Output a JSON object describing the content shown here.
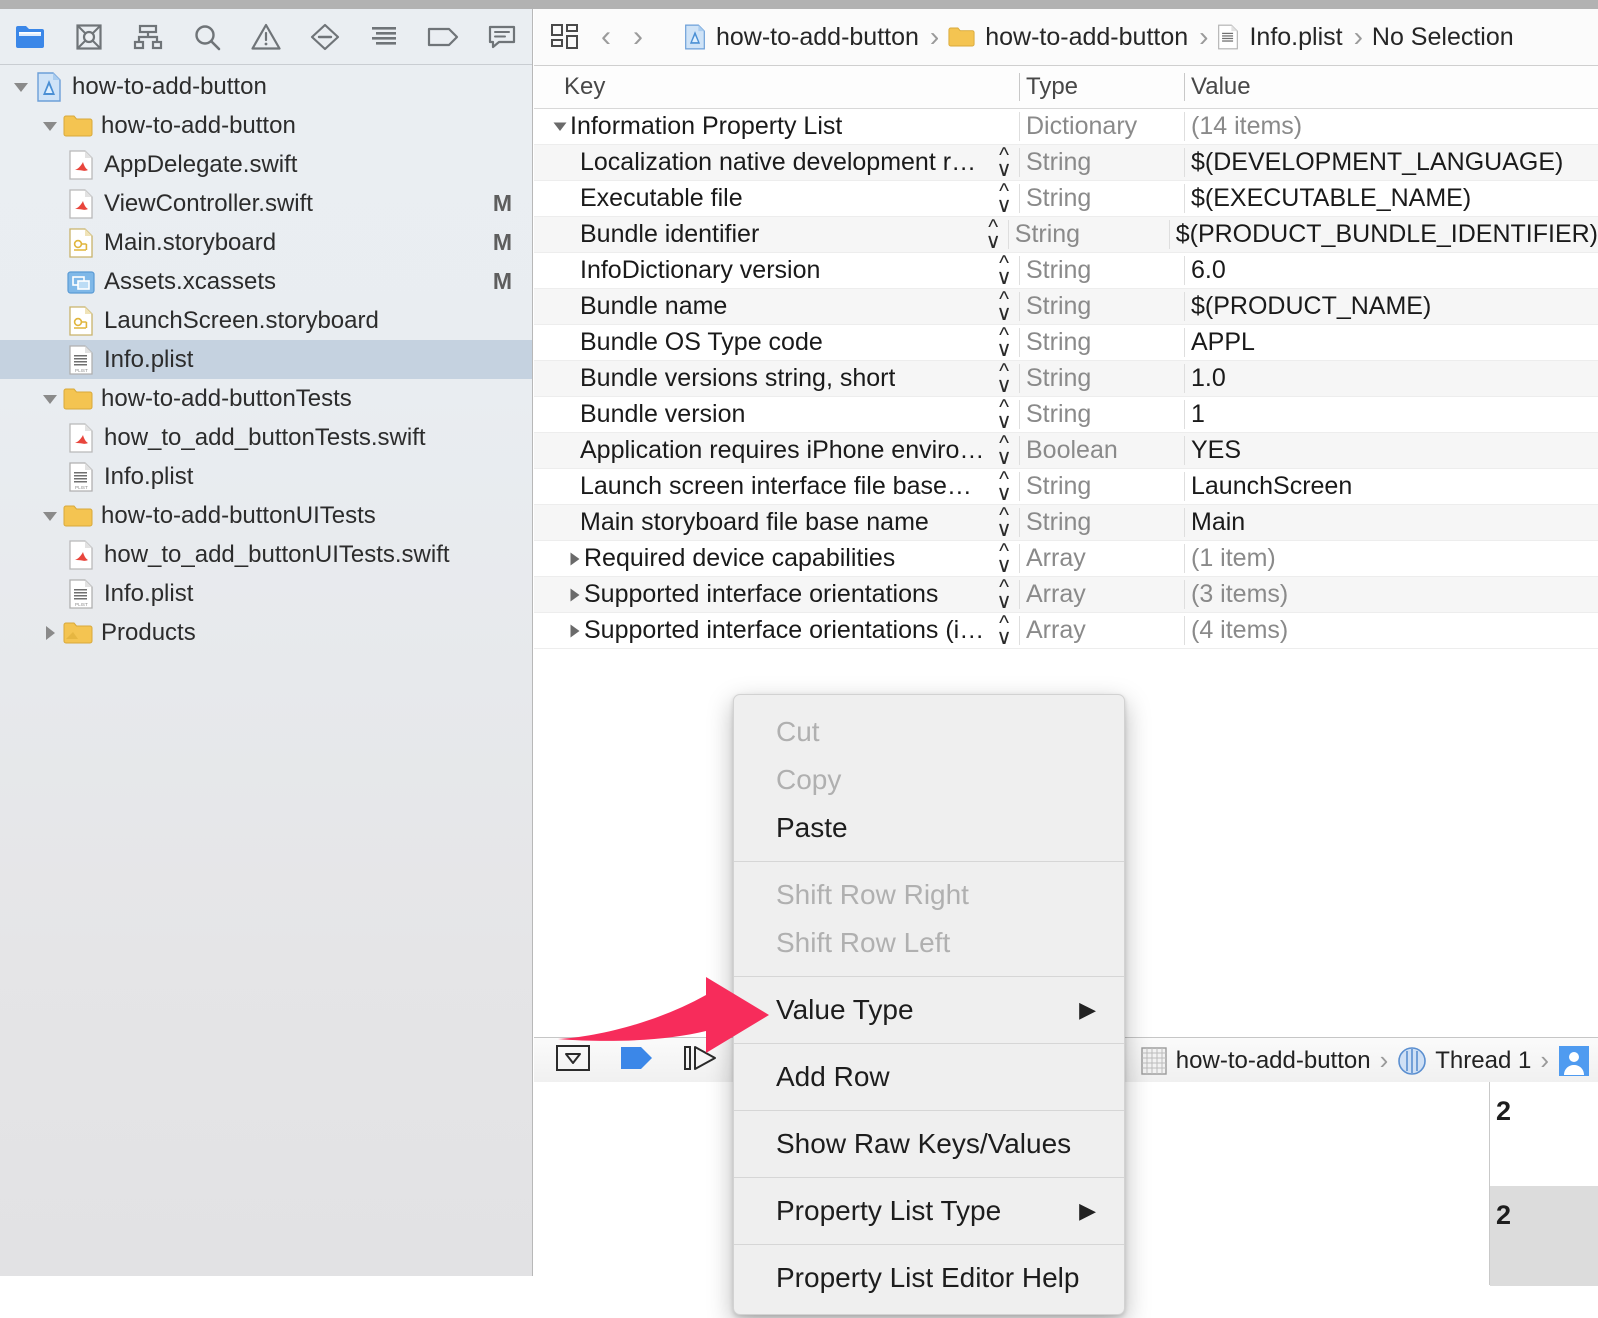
{
  "window": {
    "title": "Xcode — Info.plist"
  },
  "colors": {
    "accent_blue": "#3b87e8",
    "selection": "#c5d2e0",
    "arrow_pink": "#F72C5B",
    "menu_bg": "#efefef",
    "navigator_bg": "#e9edf1"
  },
  "navigator": {
    "toolbar_icons": [
      {
        "name": "project-navigator-icon",
        "label": "Project navigator",
        "selected": true
      },
      {
        "name": "source-control-navigator-icon",
        "label": "Source control navigator",
        "selected": false
      },
      {
        "name": "symbol-navigator-icon",
        "label": "Symbol navigator",
        "selected": false
      },
      {
        "name": "find-navigator-icon",
        "label": "Find navigator",
        "selected": false
      },
      {
        "name": "issue-navigator-icon",
        "label": "Issue navigator",
        "selected": false
      },
      {
        "name": "test-navigator-icon",
        "label": "Test navigator",
        "selected": false
      },
      {
        "name": "debug-navigator-icon",
        "label": "Debug navigator",
        "selected": false
      },
      {
        "name": "breakpoint-navigator-icon",
        "label": "Breakpoint navigator",
        "selected": false
      },
      {
        "name": "report-navigator-icon",
        "label": "Report navigator",
        "selected": false
      }
    ],
    "tree": [
      {
        "label": "how-to-add-button",
        "indent": 0,
        "icon": "xcode-project-icon",
        "twisty": "open",
        "flag": "",
        "selected": false
      },
      {
        "label": "how-to-add-button",
        "indent": 1,
        "icon": "folder-icon",
        "twisty": "open",
        "flag": "",
        "selected": false
      },
      {
        "label": "AppDelegate.swift",
        "indent": 2,
        "icon": "swift-file-icon",
        "twisty": "none",
        "flag": "",
        "selected": false
      },
      {
        "label": "ViewController.swift",
        "indent": 2,
        "icon": "swift-file-icon",
        "twisty": "none",
        "flag": "M",
        "selected": false
      },
      {
        "label": "Main.storyboard",
        "indent": 2,
        "icon": "storyboard-file-icon",
        "twisty": "none",
        "flag": "M",
        "selected": false
      },
      {
        "label": "Assets.xcassets",
        "indent": 2,
        "icon": "assets-catalog-icon",
        "twisty": "none",
        "flag": "M",
        "selected": false
      },
      {
        "label": "LaunchScreen.storyboard",
        "indent": 2,
        "icon": "storyboard-file-icon",
        "twisty": "none",
        "flag": "",
        "selected": false
      },
      {
        "label": "Info.plist",
        "indent": 2,
        "icon": "plist-file-icon",
        "twisty": "none",
        "flag": "",
        "selected": true
      },
      {
        "label": "how-to-add-buttonTests",
        "indent": 1,
        "icon": "folder-icon",
        "twisty": "open",
        "flag": "",
        "selected": false
      },
      {
        "label": "how_to_add_buttonTests.swift",
        "indent": 2,
        "icon": "swift-file-icon",
        "twisty": "none",
        "flag": "",
        "selected": false
      },
      {
        "label": "Info.plist",
        "indent": 2,
        "icon": "plist-file-icon",
        "twisty": "none",
        "flag": "",
        "selected": false
      },
      {
        "label": "how-to-add-buttonUITests",
        "indent": 1,
        "icon": "folder-icon",
        "twisty": "open",
        "flag": "",
        "selected": false
      },
      {
        "label": "how_to_add_buttonUITests.swift",
        "indent": 2,
        "icon": "swift-file-icon",
        "twisty": "none",
        "flag": "",
        "selected": false
      },
      {
        "label": "Info.plist",
        "indent": 2,
        "icon": "plist-file-icon",
        "twisty": "none",
        "flag": "",
        "selected": false
      },
      {
        "label": "Products",
        "indent": 1,
        "icon": "products-folder-icon",
        "twisty": "closed",
        "flag": "",
        "selected": false
      }
    ]
  },
  "jumpbar": {
    "items": [
      {
        "label": "how-to-add-button",
        "icon": "xcode-project-icon"
      },
      {
        "label": "how-to-add-button",
        "icon": "folder-icon"
      },
      {
        "label": "Info.plist",
        "icon": "plist-file-icon"
      },
      {
        "label": "No Selection",
        "icon": "none"
      }
    ],
    "back_label": "‹",
    "forward_label": "›",
    "related_items_icon": "related-items-icon"
  },
  "plist": {
    "headers": {
      "key": "Key",
      "type": "Type",
      "value": "Value"
    },
    "rows": [
      {
        "key": "Information Property List",
        "type": "Dictionary",
        "value": "(14 items)",
        "level": 0,
        "twisty": "open",
        "stepper": false,
        "dim_value": true
      },
      {
        "key": "Localization native development re…",
        "type": "String",
        "value": "$(DEVELOPMENT_LANGUAGE)",
        "level": 1,
        "twisty": "none",
        "stepper": true,
        "dim_value": false
      },
      {
        "key": "Executable file",
        "type": "String",
        "value": "$(EXECUTABLE_NAME)",
        "level": 1,
        "twisty": "none",
        "stepper": true,
        "dim_value": false
      },
      {
        "key": "Bundle identifier",
        "type": "String",
        "value": "$(PRODUCT_BUNDLE_IDENTIFIER)",
        "level": 1,
        "twisty": "none",
        "stepper": true,
        "dim_value": false
      },
      {
        "key": "InfoDictionary version",
        "type": "String",
        "value": "6.0",
        "level": 1,
        "twisty": "none",
        "stepper": true,
        "dim_value": false
      },
      {
        "key": "Bundle name",
        "type": "String",
        "value": "$(PRODUCT_NAME)",
        "level": 1,
        "twisty": "none",
        "stepper": true,
        "dim_value": false
      },
      {
        "key": "Bundle OS Type code",
        "type": "String",
        "value": "APPL",
        "level": 1,
        "twisty": "none",
        "stepper": true,
        "dim_value": false
      },
      {
        "key": "Bundle versions string, short",
        "type": "String",
        "value": "1.0",
        "level": 1,
        "twisty": "none",
        "stepper": true,
        "dim_value": false
      },
      {
        "key": "Bundle version",
        "type": "String",
        "value": "1",
        "level": 1,
        "twisty": "none",
        "stepper": true,
        "dim_value": false
      },
      {
        "key": "Application requires iPhone enviro…",
        "type": "Boolean",
        "value": "YES",
        "level": 1,
        "twisty": "none",
        "stepper": true,
        "dim_value": false
      },
      {
        "key": "Launch screen interface file base…",
        "type": "String",
        "value": "LaunchScreen",
        "level": 1,
        "twisty": "none",
        "stepper": true,
        "dim_value": false
      },
      {
        "key": "Main storyboard file base name",
        "type": "String",
        "value": "Main",
        "level": 1,
        "twisty": "none",
        "stepper": true,
        "dim_value": false
      },
      {
        "key": "Required device capabilities",
        "type": "Array",
        "value": "(1 item)",
        "level": 1,
        "twisty": "closed",
        "stepper": true,
        "dim_value": true
      },
      {
        "key": "Supported interface orientations",
        "type": "Array",
        "value": "(3 items)",
        "level": 1,
        "twisty": "closed",
        "stepper": true,
        "dim_value": true
      },
      {
        "key": "Supported interface orientations (i…",
        "type": "Array",
        "value": "(4 items)",
        "level": 1,
        "twisty": "closed",
        "stepper": true,
        "dim_value": true
      }
    ]
  },
  "debug_bar": {
    "buttons": [
      {
        "name": "hide-debug-area-button",
        "icon": "debug-area-toggle-icon"
      },
      {
        "name": "continue-button",
        "icon": "continue-execution-icon"
      },
      {
        "name": "step-over-button",
        "icon": "step-over-icon"
      }
    ],
    "process_path": [
      {
        "label": "how-to-add-button",
        "icon": "process-icon"
      },
      {
        "label": "Thread 1",
        "icon": "thread-icon"
      },
      {
        "label": "",
        "icon": "stack-frame-icon"
      }
    ]
  },
  "console": {
    "line_numbers": [
      "2",
      "2"
    ]
  },
  "context_menu": {
    "groups": [
      [
        {
          "label": "Cut",
          "enabled": false,
          "submenu": false
        },
        {
          "label": "Copy",
          "enabled": false,
          "submenu": false
        },
        {
          "label": "Paste",
          "enabled": true,
          "submenu": false
        }
      ],
      [
        {
          "label": "Shift Row Right",
          "enabled": false,
          "submenu": false
        },
        {
          "label": "Shift Row Left",
          "enabled": false,
          "submenu": false
        }
      ],
      [
        {
          "label": "Value Type",
          "enabled": true,
          "submenu": true
        }
      ],
      [
        {
          "label": "Add Row",
          "enabled": true,
          "submenu": false
        }
      ],
      [
        {
          "label": "Show Raw Keys/Values",
          "enabled": true,
          "submenu": false
        }
      ],
      [
        {
          "label": "Property List Type",
          "enabled": true,
          "submenu": true
        }
      ],
      [
        {
          "label": "Property List Editor Help",
          "enabled": true,
          "submenu": false
        }
      ]
    ],
    "submenu_glyph": "▶"
  },
  "annotation": {
    "arrow_name": "pink-callout-arrow",
    "points_to": "Add Row"
  }
}
